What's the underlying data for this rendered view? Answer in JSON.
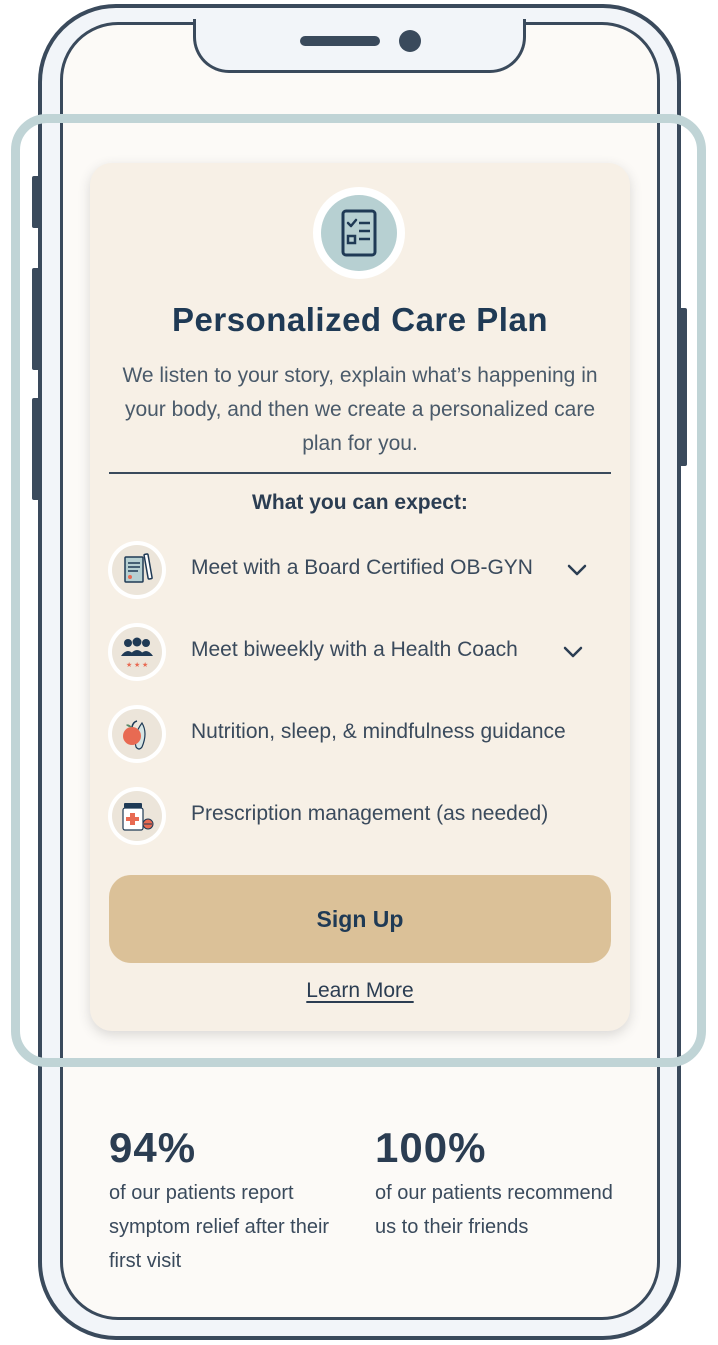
{
  "card": {
    "icon": "checklist-icon",
    "title": "Personalized Care Plan",
    "description": "We listen to your story, explain what’s happening in your body, and then we create a personalized care plan for you.",
    "expect_heading": "What you can expect:",
    "features": [
      {
        "icon": "medical-document-icon",
        "label": "Meet with a Board Certified OB-GYN",
        "expandable": true
      },
      {
        "icon": "group-rating-icon",
        "label": "Meet biweekly with a Health Coach",
        "expandable": true
      },
      {
        "icon": "apple-icon",
        "label": "Nutrition, sleep, & mindfulness guidance",
        "expandable": false
      },
      {
        "icon": "medicine-bottle-icon",
        "label": "Prescription management (as needed)",
        "expandable": false
      }
    ],
    "signup_label": "Sign Up",
    "learn_more_label": "Learn More"
  },
  "stats": [
    {
      "value": "94%",
      "description": "of our patients report symptom relief after their first visit"
    },
    {
      "value": "100%",
      "description": "of our patients recommend us to their friends"
    }
  ],
  "colors": {
    "card_bg": "#f7f0e6",
    "button_bg": "#dbc198",
    "title": "#1f3a55",
    "highlight": "#c0d4d6",
    "device_frame": "#3a4a5c"
  }
}
